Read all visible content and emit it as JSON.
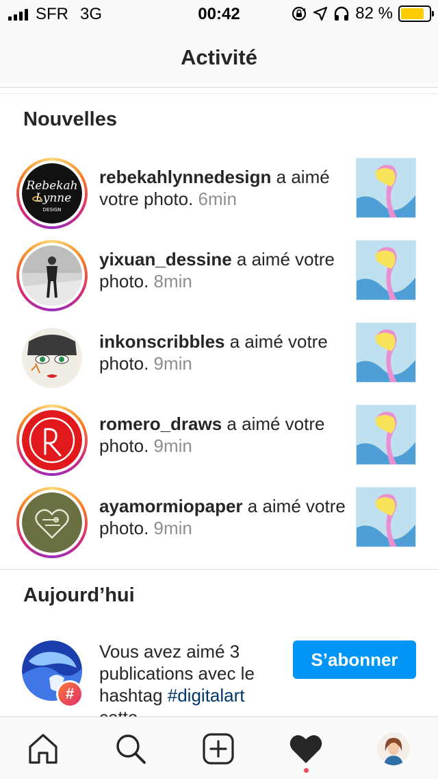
{
  "status_bar": {
    "carrier": "SFR",
    "network": "3G",
    "time": "00:42",
    "battery_percent": "82 %",
    "battery_level": 0.82,
    "icons": [
      "signal-icon",
      "rotation-lock-icon",
      "location-icon",
      "headphones-icon",
      "battery-icon"
    ]
  },
  "header": {
    "title": "Activité"
  },
  "sections": {
    "new_title": "Nouvelles",
    "today_title": "Aujourd’hui"
  },
  "activity": [
    {
      "username": "rebekahlynnedesign",
      "action": "a aimé votre photo.",
      "time": "6min",
      "story_ring": true
    },
    {
      "username": "yixuan_dessine",
      "action": "a aimé votre photo.",
      "time": "8min",
      "story_ring": true
    },
    {
      "username": "inkonscribbles",
      "action": "a aimé votre photo.",
      "time": "9min",
      "story_ring": false
    },
    {
      "username": "romero_draws",
      "action": "a aimé votre photo.",
      "time": "9min",
      "story_ring": true
    },
    {
      "username": "ayamormiopaper",
      "action": "a aimé votre photo.",
      "time": "9min",
      "story_ring": true
    }
  ],
  "today": {
    "text": "Vous avez aimé 3 publications avec le hashtag",
    "hashtag": "#digitalart",
    "text_cut": "cette",
    "badge": "#",
    "follow_label": "S’abonner"
  },
  "tabs": [
    "home",
    "search",
    "add",
    "activity",
    "profile"
  ],
  "colors": {
    "accent": "#0095f6",
    "battery": "#ffcc00",
    "notification_dot": "#ed4956",
    "muted_text": "#8e8e8e",
    "hashtag": "#003569"
  }
}
